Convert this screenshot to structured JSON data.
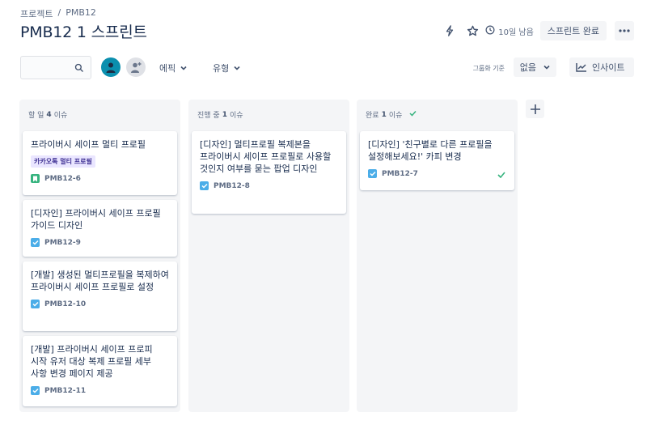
{
  "breadcrumb": {
    "project": "프로젝트",
    "separator": "/",
    "key": "PMB12"
  },
  "page_title": "PMB12 1 스프린트",
  "header": {
    "days_left": "10일 남음",
    "complete_label": "스프린트 완료"
  },
  "toolbar": {
    "search_placeholder": "",
    "epic_label": "에픽",
    "type_label": "유형",
    "groupby_label": "그룹화 기준",
    "groupby_value": "없음",
    "insight_label": "인사이트"
  },
  "columns": [
    {
      "name": "할 일",
      "count": "4",
      "unit": "이슈",
      "cards": [
        {
          "title": "프라이버시 세이프 멀티 프로필",
          "epic": "카카오톡 멀티 프로필",
          "key": "PMB12-6",
          "type": "story"
        },
        {
          "title": "[디자인] 프라이버시 세이프 프로필 가이드 디자인",
          "key": "PMB12-9",
          "type": "task"
        },
        {
          "title": "[개발] 생성된 멀티프로필을 복제하여 프라이버시 세이프 프로필로 설정",
          "key": "PMB12-10",
          "type": "task"
        },
        {
          "title": "[개발] 프라이버시 세이프 프로피 시작 유저 대상 복제 프로필 세부 사항 변경 페이지 제공",
          "key": "PMB12-11",
          "type": "task"
        }
      ]
    },
    {
      "name": "진행 중",
      "count": "1",
      "unit": "이슈",
      "cards": [
        {
          "title": "[디자인] 멀티프로필 복제본을 프라이버시 세이프 프로필로 사용할 것인지 여부를 묻는 팝업 디자인",
          "key": "PMB12-8",
          "type": "task"
        }
      ]
    },
    {
      "name": "완료",
      "count": "1",
      "unit": "이슈",
      "cards": [
        {
          "title": "[디자인] '친구별로 다른 프로필을 설정해보세요!' 카피 변경",
          "key": "PMB12-7",
          "type": "task",
          "done": true
        }
      ]
    }
  ],
  "colors": {
    "accent": "#0052cc",
    "story": "#36b37e",
    "task": "#4bade8",
    "avatar": "#0b8fae",
    "epic_bg": "#eae6ff",
    "epic_text": "#403294"
  }
}
